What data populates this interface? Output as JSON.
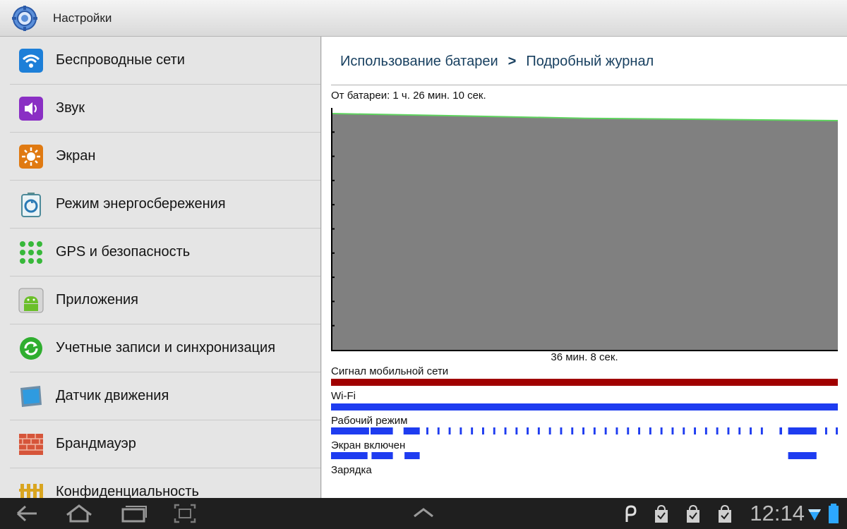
{
  "app": {
    "title": "Настройки"
  },
  "sidebar": {
    "items": [
      {
        "label": "Беспроводные сети",
        "icon": "wifi-icon"
      },
      {
        "label": "Звук",
        "icon": "speaker-icon"
      },
      {
        "label": "Экран",
        "icon": "brightness-icon"
      },
      {
        "label": "Режим энергосбережения",
        "icon": "power-saving-icon"
      },
      {
        "label": "GPS и безопасность",
        "icon": "gps-security-icon"
      },
      {
        "label": "Приложения",
        "icon": "android-icon"
      },
      {
        "label": "Учетные записи и синхронизация",
        "icon": "sync-icon"
      },
      {
        "label": "Датчик движения",
        "icon": "motion-sensor-icon"
      },
      {
        "label": "Брандмауэр",
        "icon": "firewall-icon"
      },
      {
        "label": "Конфиденциальность",
        "icon": "fence-icon"
      }
    ]
  },
  "detail": {
    "breadcrumb": {
      "parent": "Использование батареи",
      "separator": ">",
      "current": "Подробный журнал"
    },
    "battery_time": "От батареи: 1 ч. 26 мин. 10 сек.",
    "graph_caption": "36 мин. 8 сек.",
    "colors": {
      "graph_fill": "#808080",
      "graph_line": "#5fd35f",
      "signal": "#a00000",
      "blue": "#1e3cf0"
    },
    "tracks": [
      {
        "label": "Сигнал мобильной сети"
      },
      {
        "label": "Wi-Fi"
      },
      {
        "label": "Рабочий режим"
      },
      {
        "label": "Экран включен"
      },
      {
        "label": "Зарядка"
      }
    ]
  },
  "chart_data": {
    "type": "area",
    "series": [
      {
        "values": [
          100,
          99,
          98,
          97.5,
          97
        ]
      },
      {
        "name": "Сигнал мобильной сети",
        "segments": [
          [
            0,
            1
          ]
        ]
      },
      {
        "name": "Wi-Fi",
        "segments": [
          [
            0,
            1
          ]
        ]
      },
      {
        "name": "Рабочий режим",
        "segments": [
          [
            0,
            0.075
          ],
          [
            0.078,
            0.122
          ],
          [
            0.143,
            0.175
          ],
          [
            0.188,
            0.192
          ],
          [
            0.21,
            0.214
          ],
          [
            0.232,
            0.236
          ],
          [
            0.254,
            0.258
          ],
          [
            0.276,
            0.28
          ],
          [
            0.298,
            0.302
          ],
          [
            0.32,
            0.324
          ],
          [
            0.342,
            0.346
          ],
          [
            0.364,
            0.368
          ],
          [
            0.386,
            0.39
          ],
          [
            0.408,
            0.412
          ],
          [
            0.43,
            0.434
          ],
          [
            0.452,
            0.456
          ],
          [
            0.474,
            0.478
          ],
          [
            0.496,
            0.5
          ],
          [
            0.518,
            0.522
          ],
          [
            0.54,
            0.544
          ],
          [
            0.562,
            0.566
          ],
          [
            0.584,
            0.588
          ],
          [
            0.606,
            0.61
          ],
          [
            0.628,
            0.632
          ],
          [
            0.65,
            0.654
          ],
          [
            0.672,
            0.676
          ],
          [
            0.694,
            0.698
          ],
          [
            0.716,
            0.72
          ],
          [
            0.738,
            0.742
          ],
          [
            0.76,
            0.764
          ],
          [
            0.782,
            0.786
          ],
          [
            0.804,
            0.808
          ],
          [
            0.826,
            0.83
          ],
          [
            0.848,
            0.852
          ],
          [
            0.885,
            0.89
          ],
          [
            0.902,
            0.958
          ],
          [
            0.975,
            0.979
          ],
          [
            0.996,
            1
          ]
        ]
      },
      {
        "name": "Экран включен",
        "segments": [
          [
            0,
            0.072
          ],
          [
            0.08,
            0.122
          ],
          [
            0.145,
            0.175
          ],
          [
            0.902,
            0.958
          ]
        ]
      },
      {
        "name": "Зарядка",
        "segments": []
      }
    ]
  },
  "status": {
    "clock": "12:14",
    "notifications": [
      "carrier-icon",
      "shopping-bag-icon",
      "shopping-bag-icon",
      "shopping-bag-icon"
    ]
  }
}
